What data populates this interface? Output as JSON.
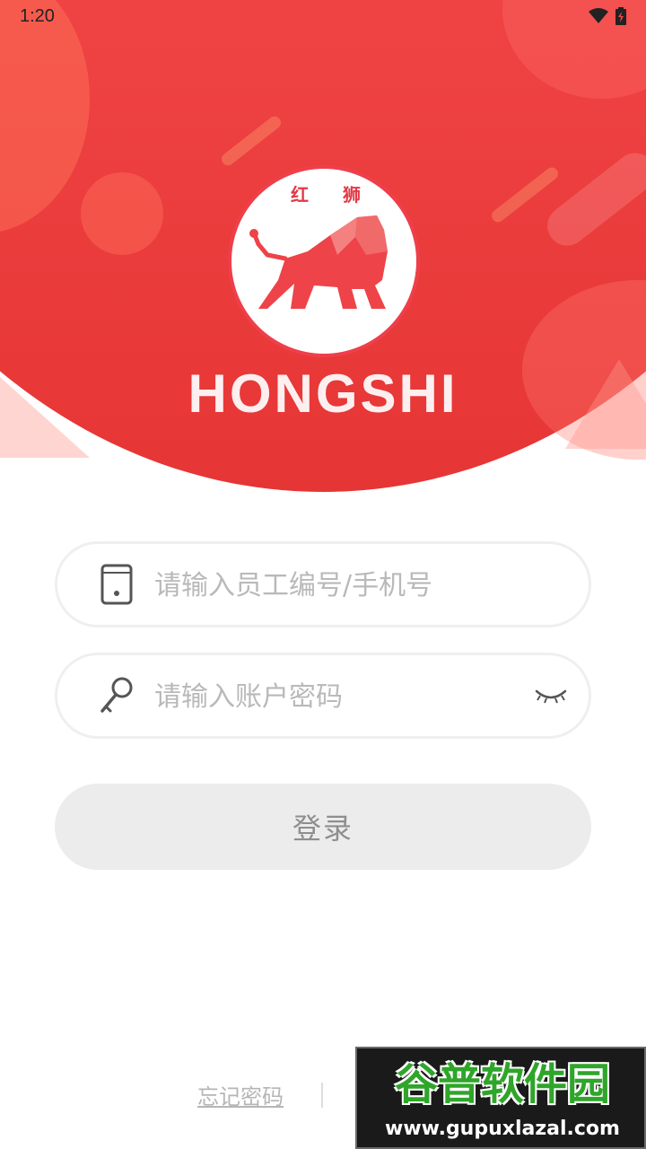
{
  "status_bar": {
    "time": "1:20",
    "icons": [
      "wifi-icon",
      "battery-charging-icon"
    ]
  },
  "header": {
    "logo_text_left": "红",
    "logo_text_right": "狮",
    "brand_name": "HONGSHI",
    "colors": {
      "primary": "#ef4242",
      "accent": "#f7504f"
    }
  },
  "form": {
    "account_placeholder": "请输入员工编号/手机号",
    "account_value": "",
    "password_placeholder": "请输入账户密码",
    "password_value": "",
    "login_label": "登录"
  },
  "footer": {
    "forgot_password": "忘记密码"
  },
  "watermark": {
    "title": "谷普软件园",
    "url": "www.gupuxlazal.com"
  }
}
